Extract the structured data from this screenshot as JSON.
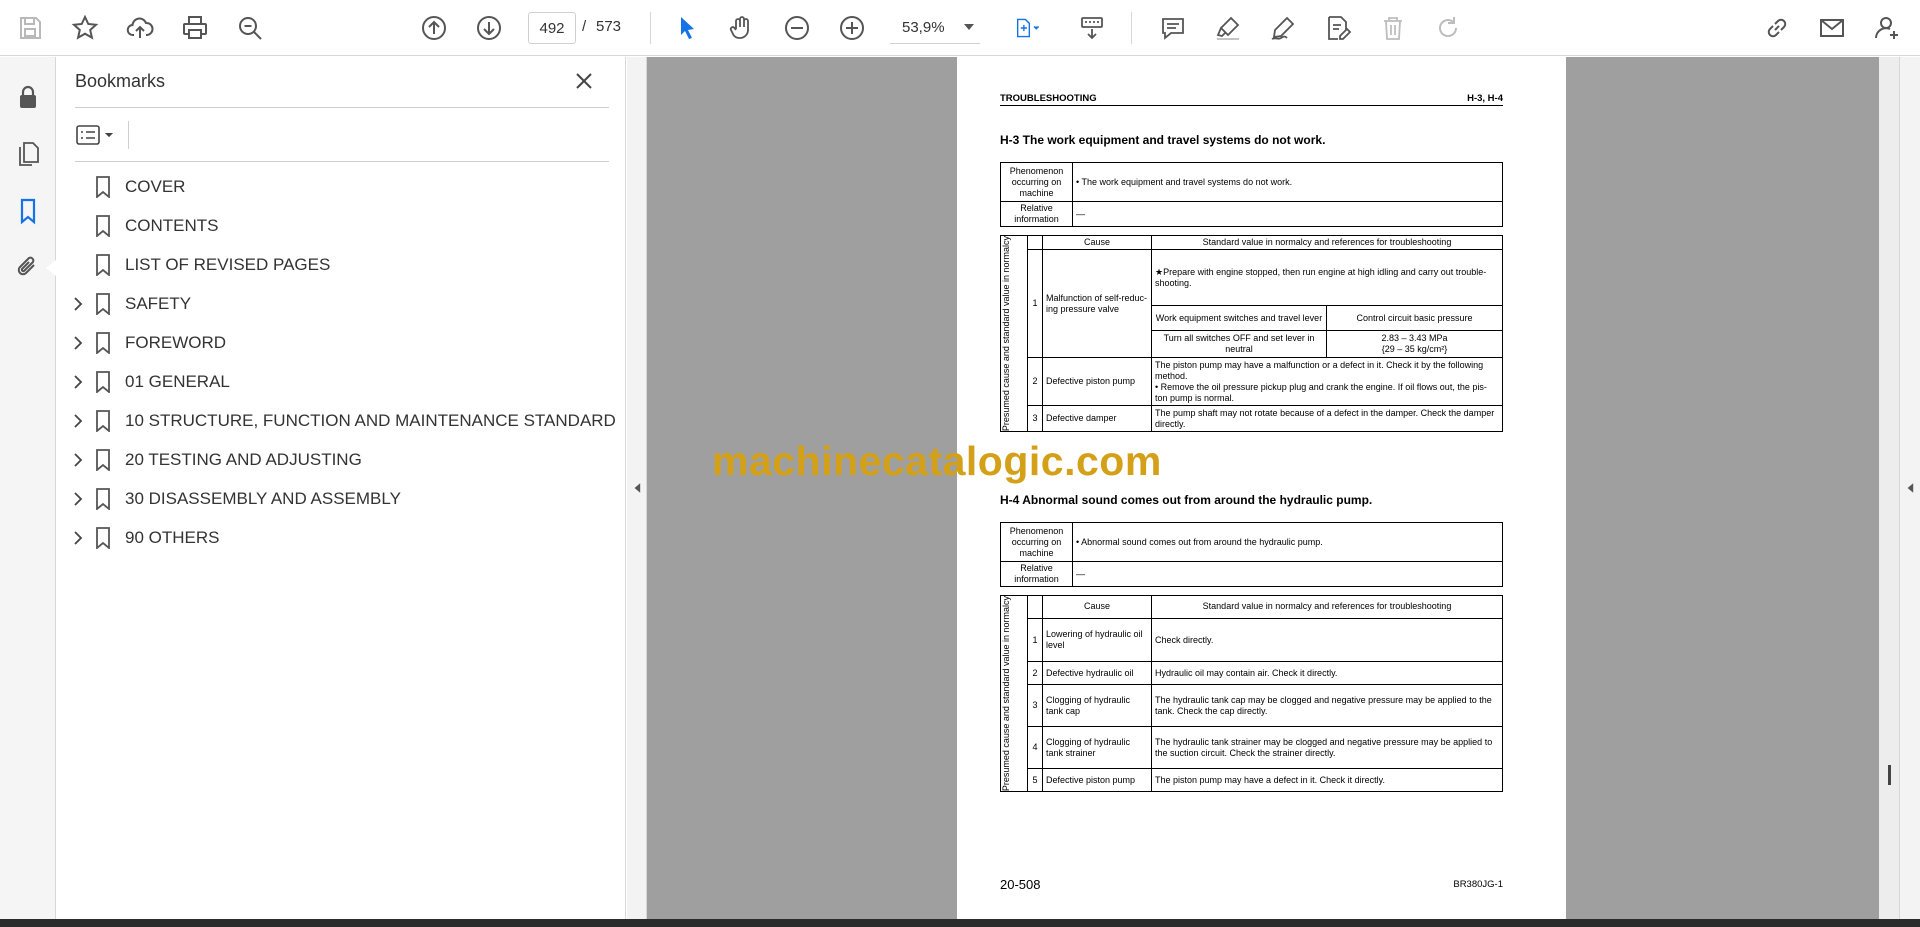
{
  "toolbar": {
    "current_page": "492",
    "page_separator": "/",
    "total_pages": "573",
    "zoom": "53,9%"
  },
  "bookmarks": {
    "title": "Bookmarks",
    "items": [
      {
        "label": "COVER",
        "expandable": false
      },
      {
        "label": "CONTENTS",
        "expandable": false
      },
      {
        "label": "LIST OF REVISED PAGES",
        "expandable": false
      },
      {
        "label": "SAFETY",
        "expandable": true
      },
      {
        "label": "FOREWORD",
        "expandable": true
      },
      {
        "label": "01 GENERAL",
        "expandable": true
      },
      {
        "label": "10 STRUCTURE, FUNCTION AND MAINTENANCE STANDARD",
        "expandable": true
      },
      {
        "label": "20 TESTING AND ADJUSTING",
        "expandable": true
      },
      {
        "label": "30 DISASSEMBLY AND ASSEMBLY",
        "expandable": true
      },
      {
        "label": "90 OTHERS",
        "expandable": true
      }
    ]
  },
  "page": {
    "header_left": "TROUBLESHOOTING",
    "header_right": "H-3, H-4",
    "h3": {
      "title": "H-3  The work equipment and travel systems do not work.",
      "phenomenon_label": "Phenomenon occurring on machine",
      "phenomenon_text": "•  The work equipment and travel systems do not work.",
      "relative_label": "Relative information",
      "relative_text": "—",
      "side_label": "Presumed cause and standard value in normalcy",
      "col_cause": "Cause",
      "col_standard": "Standard value in normalcy and references for troubleshooting",
      "rows": [
        {
          "no": "1",
          "cause": "Malfunction of self-reduc-ing pressure valve",
          "note": "★Prepare with engine stopped, then run engine at high idling and carry out trouble-shooting.",
          "sub_h1": "Work equipment switches and travel lever",
          "sub_h2": "Control circuit basic pressure",
          "sub_v1": "Turn all switches OFF and set lever in neutral",
          "sub_v2a": "2.83 – 3.43 MPa",
          "sub_v2b": "{29 – 35 kg/cm²}"
        },
        {
          "no": "2",
          "cause": "Defective piston pump",
          "text": "The piston pump may have a malfunction or a defect in it.  Check it by the following method.",
          "text2": "•  Remove the oil pressure pickup plug and crank the engine.  If oil flows out, the pis-ton pump is normal."
        },
        {
          "no": "3",
          "cause": "Defective damper",
          "text": "The pump shaft may not rotate because of a defect in the damper.  Check the damper directly."
        }
      ]
    },
    "h4": {
      "title": "H-4  Abnormal sound comes out from around the hydraulic pump.",
      "phenomenon_label": "Phenomenon occurring on machine",
      "phenomenon_text": "•  Abnormal sound comes out from around the hydraulic pump.",
      "relative_label": "Relative information",
      "relative_text": "—",
      "side_label": "Presumed cause and standard value in normalcy",
      "col_cause": "Cause",
      "col_standard": "Standard value in normalcy and references for troubleshooting",
      "rows": [
        {
          "no": "1",
          "cause": "Lowering of hydraulic oil level",
          "text": "Check directly."
        },
        {
          "no": "2",
          "cause": "Defective hydraulic oil",
          "text": "Hydraulic oil may contain air.  Check it directly."
        },
        {
          "no": "3",
          "cause": "Clogging of hydraulic tank cap",
          "text": "The hydraulic tank cap may be clogged and negative pressure may be applied to the tank.  Check the cap directly."
        },
        {
          "no": "4",
          "cause": "Clogging of hydraulic tank strainer",
          "text": "The hydraulic tank strainer may be clogged and negative pressure may be applied to the suction circuit.  Check the strainer directly."
        },
        {
          "no": "5",
          "cause": "Defective piston pump",
          "text": "The piston pump may have a defect in it.  Check it directly."
        }
      ]
    },
    "page_number": "20-508",
    "model": "BR380JG-1"
  },
  "watermark": "machinecatalogic.com",
  "colors": {
    "accent_blue": "#1473e6",
    "icon_gray": "#555555",
    "watermark": "#d4a017",
    "doc_background": "#9f9f9f"
  }
}
